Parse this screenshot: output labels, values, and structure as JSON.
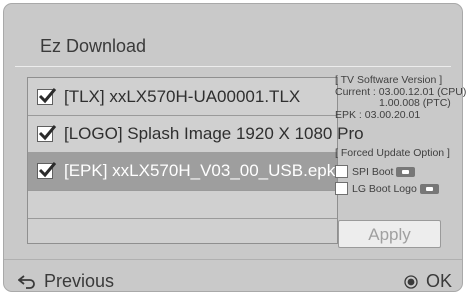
{
  "dialog": {
    "title": "Ez Download"
  },
  "files": [
    {
      "label": "[TLX] xxLX570H-UA00001.TLX",
      "checked": true,
      "selected": false
    },
    {
      "label": "[LOGO] Splash Image 1920 X 1080 Pro",
      "checked": true,
      "selected": false
    },
    {
      "label": "[EPK] xxLX570H_V03_00_USB.epk",
      "checked": true,
      "selected": true
    }
  ],
  "software_info": {
    "heading": "[ TV Software Version ]",
    "current_line1": "Current : 03.00.12.01 (CPU)",
    "current_line2": "1.00.008 (PTC)",
    "epk": "EPK : 03.00.20.01"
  },
  "forced_update": {
    "heading": "[ Forced Update Option ]",
    "spi_boot": "SPI Boot",
    "lg_boot_logo": "LG Boot Logo"
  },
  "apply_label": "Apply",
  "footer": {
    "previous": "Previous",
    "ok": "OK"
  },
  "colors": {
    "panel": "#c9c9c9",
    "selected_row": "#9e9e9e",
    "text": "#3a3a3a"
  }
}
